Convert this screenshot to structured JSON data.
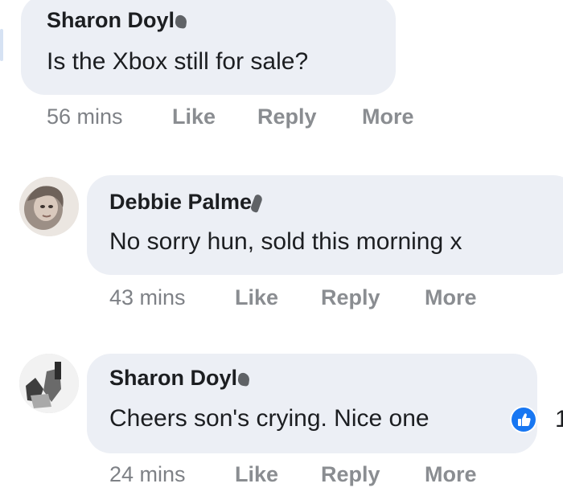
{
  "comments": [
    {
      "author": "Sharon Doyl",
      "text": "Is the Xbox still for sale?",
      "time": "56 mins",
      "actions": [
        "Like",
        "Reply",
        "More"
      ]
    },
    {
      "author": "Debbie Palme",
      "text": "No sorry hun, sold this morning x",
      "time": "43 mins",
      "actions": [
        "Like",
        "Reply",
        "More"
      ],
      "avatar": "profile-photo"
    },
    {
      "author": "Sharon Doyl",
      "text": "Cheers son's crying. Nice one",
      "time": "24 mins",
      "actions": [
        "Like",
        "Reply",
        "More"
      ],
      "avatar": "profile-photo",
      "reaction": "like-icon",
      "reaction_count_fragment": "1"
    }
  ],
  "colors": {
    "bubble": "#eceff5",
    "text": "#1c1e21",
    "meta": "#8a8d91",
    "like_blue": "#1877f2"
  }
}
